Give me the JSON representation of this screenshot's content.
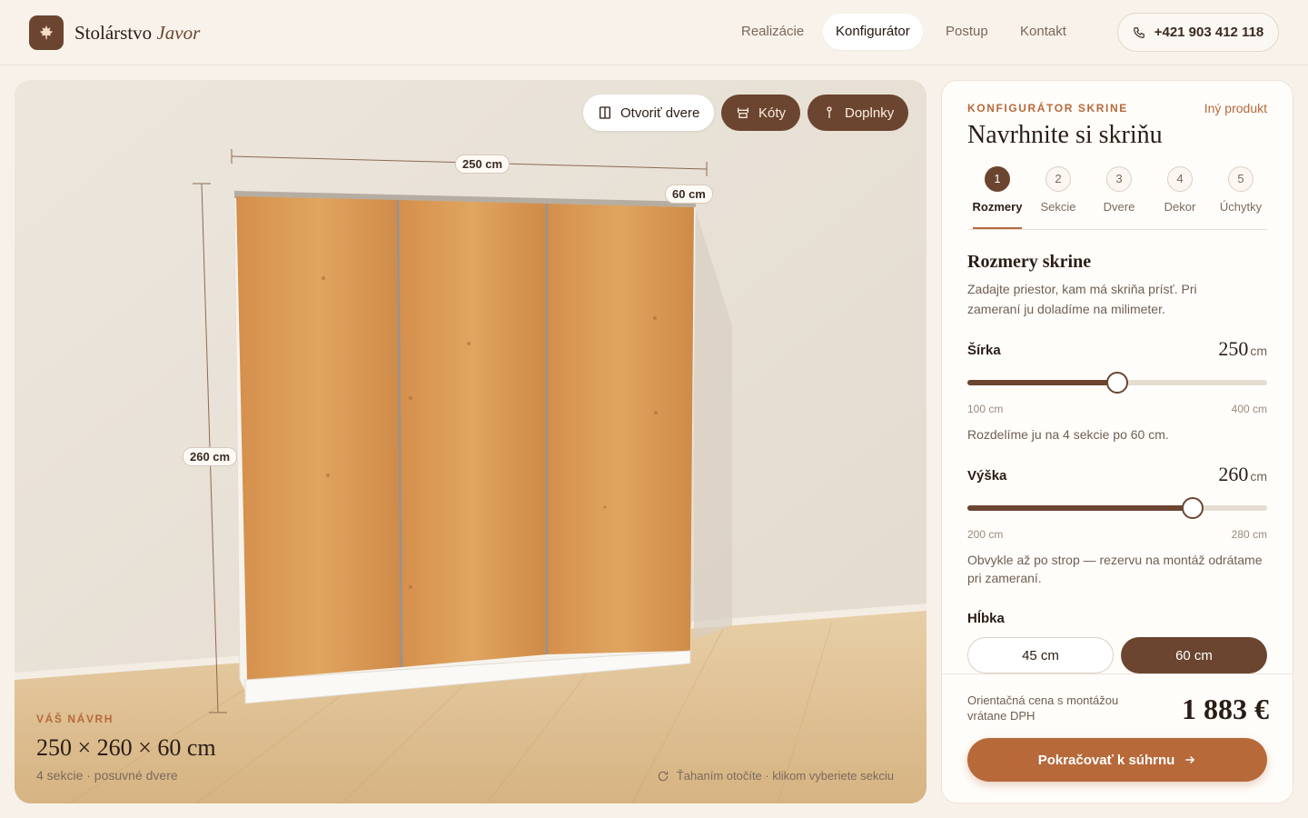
{
  "brand": {
    "name": "Stolárstvo",
    "name_accent": "Javor"
  },
  "nav": {
    "items": [
      "Realizácie",
      "Konfigurátor",
      "Postup",
      "Kontakt"
    ],
    "active": "Konfigurátor"
  },
  "phone": "+421 903 412 118",
  "viewer": {
    "toolbar": {
      "open_doors": "Otvoriť dvere",
      "dimensions": "Kóty",
      "extras": "Doplnky"
    },
    "dims": {
      "width": "250 cm",
      "height": "260 cm",
      "depth": "60 cm"
    },
    "design": {
      "kicker": "VÁŠ NÁVRH",
      "dims": "250 × 260 × 60 cm",
      "sub": "4 sekcie · posuvné dvere"
    },
    "hint": "Ťahaním otočíte · klikom vyberiete sekciu"
  },
  "panel": {
    "kicker": "KONFIGURÁTOR SKRINE",
    "other_product": "Iný produkt",
    "title": "Navrhnite si skriňu",
    "steps": [
      {
        "num": "1",
        "label": "Rozmery"
      },
      {
        "num": "2",
        "label": "Sekcie"
      },
      {
        "num": "3",
        "label": "Dvere"
      },
      {
        "num": "4",
        "label": "Dekor"
      },
      {
        "num": "5",
        "label": "Úchytky"
      }
    ],
    "section_title": "Rozmery skrine",
    "section_desc": "Zadajte priestor, kam má skriňa prísť. Pri zameraní ju doladíme na milimeter.",
    "width": {
      "label": "Šírka",
      "value": "250",
      "unit": "cm",
      "min": "100 cm",
      "max": "400 cm",
      "fraction": 0.5,
      "note": "Rozdelíme ju na 4 sekcie po 60 cm."
    },
    "height": {
      "label": "Výška",
      "value": "260",
      "unit": "cm",
      "min": "200 cm",
      "max": "280 cm",
      "fraction": 0.75,
      "note": "Obvykle až po strop — rezervu na montáž odrátame pri zameraní."
    },
    "depth": {
      "label": "Hĺbka",
      "options": [
        "45 cm",
        "60 cm"
      ],
      "selected": "60 cm"
    },
    "price_label": "Orientačná cena s montážou vrátane DPH",
    "price": "1 883 €",
    "cta": "Pokračovať k súhrnu"
  },
  "colors": {
    "accent": "#b7693a",
    "brown": "#6b4530",
    "wood": "#d99a55"
  }
}
